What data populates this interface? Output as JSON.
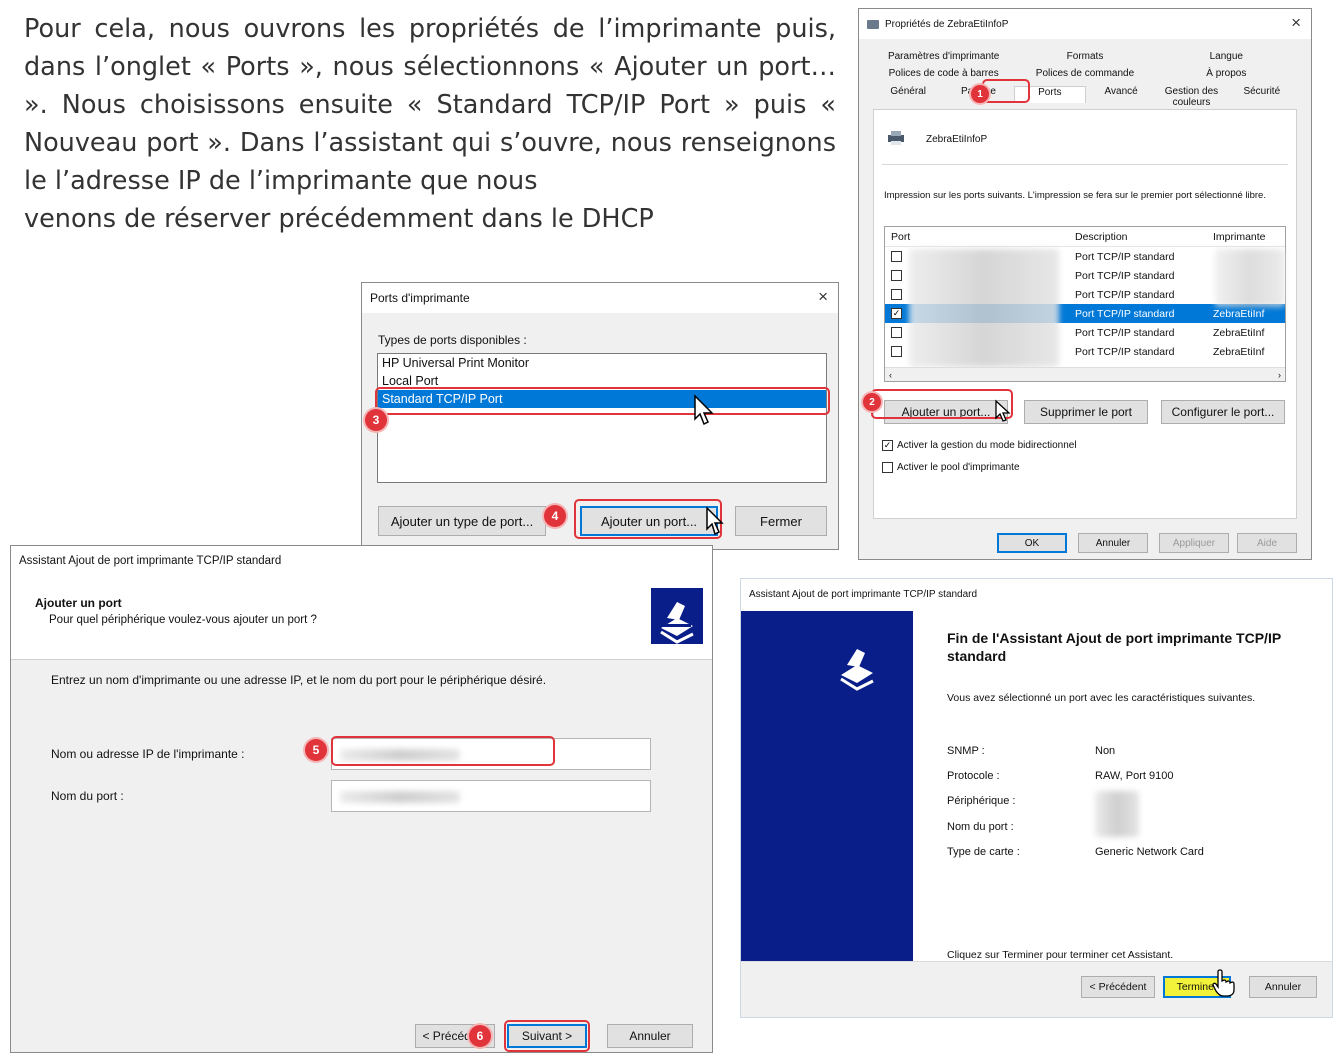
{
  "intro": {
    "text": "Pour cela, nous ouvrons les propriétés de l’imprimante puis, dans l’onglet « Ports », nous sélectionnons « Ajouter un port… ». Nous choisissons ensuite « Standard TCP/IP Port » puis « Nouveau port ». Dans l’assistant qui s’ouvre, nous renseignons le l’adresse IP de l’imprimante que nous",
    "last_line": "venons de réserver précédemment dans le DHCP"
  },
  "props_dialog": {
    "title": "Propriétés de ZebraEtiInfoP",
    "close": "×",
    "tabs_row1": [
      "Paramètres d'imprimante",
      "Formats",
      "Langue"
    ],
    "tabs_row2": [
      "Polices de code à barres",
      "Polices de commande",
      "À propos"
    ],
    "tabs_row3": [
      "Général",
      "Partage",
      "Ports",
      "Avancé",
      "Gestion des couleurs",
      "Sécurité"
    ],
    "printer_name": "ZebraEtiInfoP",
    "description": "Impression sur les ports suivants. L'impression se fera sur le premier port sélectionné libre.",
    "columns": [
      "Port",
      "Description",
      "Imprimante"
    ],
    "rows": [
      {
        "description": "Port TCP/IP standard",
        "printer": "",
        "checked": false,
        "selected": false
      },
      {
        "description": "Port TCP/IP standard",
        "printer": "",
        "checked": false,
        "selected": false
      },
      {
        "description": "Port TCP/IP standard",
        "printer": "",
        "checked": false,
        "selected": false
      },
      {
        "description": "Port TCP/IP standard",
        "printer": "ZebraEtiInf",
        "checked": true,
        "selected": true
      },
      {
        "description": "Port TCP/IP standard",
        "printer": "ZebraEtiInf",
        "checked": false,
        "selected": false
      },
      {
        "description": "Port TCP/IP standard",
        "printer": "ZebraEtiInf",
        "checked": false,
        "selected": false
      }
    ],
    "buttons": {
      "add_port": "Ajouter un port...",
      "delete_port": "Supprimer le port",
      "config_port": "Configurer le port..."
    },
    "checkbox_bidir": "Activer la gestion du mode bidirectionnel",
    "checkbox_pool": "Activer le pool d'imprimante",
    "footer": {
      "ok": "OK",
      "cancel": "Annuler",
      "apply": "Appliquer",
      "help": "Aide"
    }
  },
  "ports_dialog": {
    "title": "Ports d'imprimante",
    "close": "×",
    "label": "Types de ports disponibles :",
    "items": [
      "HP Universal Print Monitor",
      "Local Port",
      "Standard TCP/IP Port"
    ],
    "buttons": {
      "add_type": "Ajouter un type de port...",
      "add_port": "Ajouter un port...",
      "close": "Fermer"
    }
  },
  "wizard1": {
    "title": "Assistant Ajout de port imprimante TCP/IP standard",
    "heading": "Ajouter un port",
    "subheading": "Pour quel périphérique voulez-vous ajouter un port ?",
    "instruction": "Entrez un nom d'imprimante ou une adresse IP, et le nom du port pour le périphérique désiré.",
    "label_ip": "Nom ou adresse IP de l'imprimante :",
    "label_port": "Nom du port :",
    "buttons": {
      "previous": "< Précédent",
      "next": "Suivant >",
      "cancel": "Annuler"
    }
  },
  "wizard2": {
    "title": "Assistant Ajout de port imprimante TCP/IP standard",
    "heading": "Fin de l'Assistant Ajout de port imprimante TCP/IP standard",
    "intro": "Vous avez sélectionné un port avec les caractéristiques suivantes.",
    "snmp_label": "SNMP :",
    "snmp_value": "Non",
    "protocol_label": "Protocole :",
    "protocol_value": "RAW, Port 9100",
    "device_label": "Périphérique :",
    "portname_label": "Nom du port :",
    "card_label": "Type de carte :",
    "card_value": "Generic Network Card",
    "finish_text": "Cliquez sur Terminer pour terminer cet Assistant.",
    "buttons": {
      "previous": "< Précédent",
      "finish": "Terminer",
      "cancel": "Annuler"
    }
  },
  "steps": [
    "1",
    "2",
    "3",
    "4",
    "5",
    "6"
  ],
  "colors": {
    "highlight_red": "#e0333a",
    "selection_blue": "#0078d7",
    "wizard_panel": "#0a1e8a",
    "finish_yellow": "#f2f23a"
  }
}
